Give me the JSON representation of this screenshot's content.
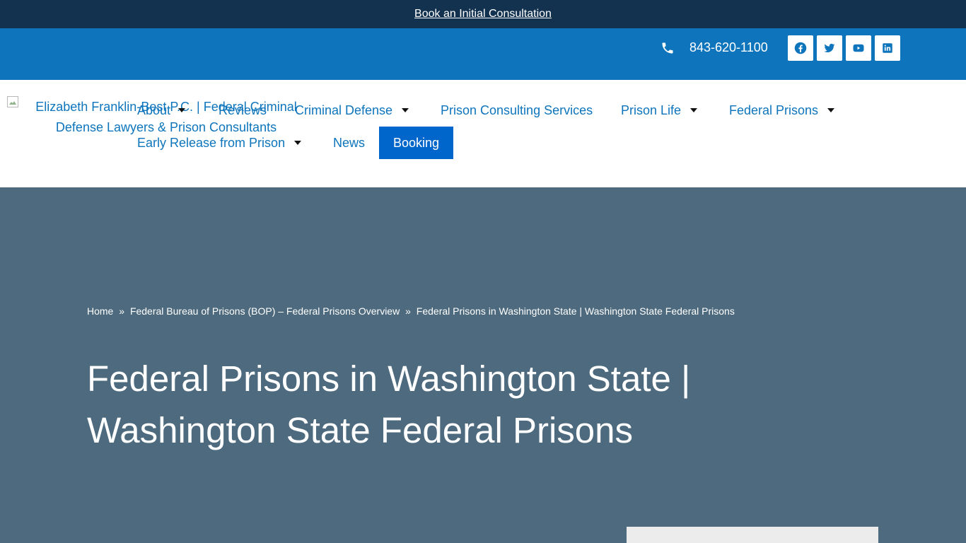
{
  "topbar": {
    "cta_label": "Book an Initial Consultation"
  },
  "contact": {
    "phone": "843-620-1100",
    "social": [
      {
        "icon": "facebook-icon"
      },
      {
        "icon": "twitter-icon"
      },
      {
        "icon": "youtube-icon"
      },
      {
        "icon": "linkedin-icon"
      }
    ]
  },
  "logo": {
    "alt_text": "Elizabeth Franklin-Best P.C. | Federal Criminal Defense Lawyers & Prison Consultants"
  },
  "nav": {
    "items": [
      {
        "label": "About",
        "has_dropdown": true
      },
      {
        "label": "Reviews",
        "has_dropdown": false
      },
      {
        "label": "Criminal Defense",
        "has_dropdown": true
      },
      {
        "label": "Prison Consulting Services",
        "has_dropdown": false
      },
      {
        "label": "Prison Life",
        "has_dropdown": true
      },
      {
        "label": "Federal Prisons",
        "has_dropdown": true
      },
      {
        "label": "Early Release from Prison",
        "has_dropdown": true
      },
      {
        "label": "News",
        "has_dropdown": false
      }
    ],
    "booking_label": "Booking"
  },
  "breadcrumb": {
    "items": [
      "Home",
      "Federal Bureau of Prisons (BOP) – Federal Prisons Overview",
      "Federal Prisons in Washington State | Washington State Federal Prisons"
    ],
    "separator": "»"
  },
  "page": {
    "title_line1": "Federal Prisons in Washington State |",
    "title_line2": "Washington State Federal Prisons"
  },
  "colors": {
    "topbar_bg": "#13324f",
    "contactbar_bg": "#0e75bc",
    "nav_text": "#0e75bc",
    "booking_bg": "#0066cc",
    "hero_bg": "#4e6a7e"
  }
}
